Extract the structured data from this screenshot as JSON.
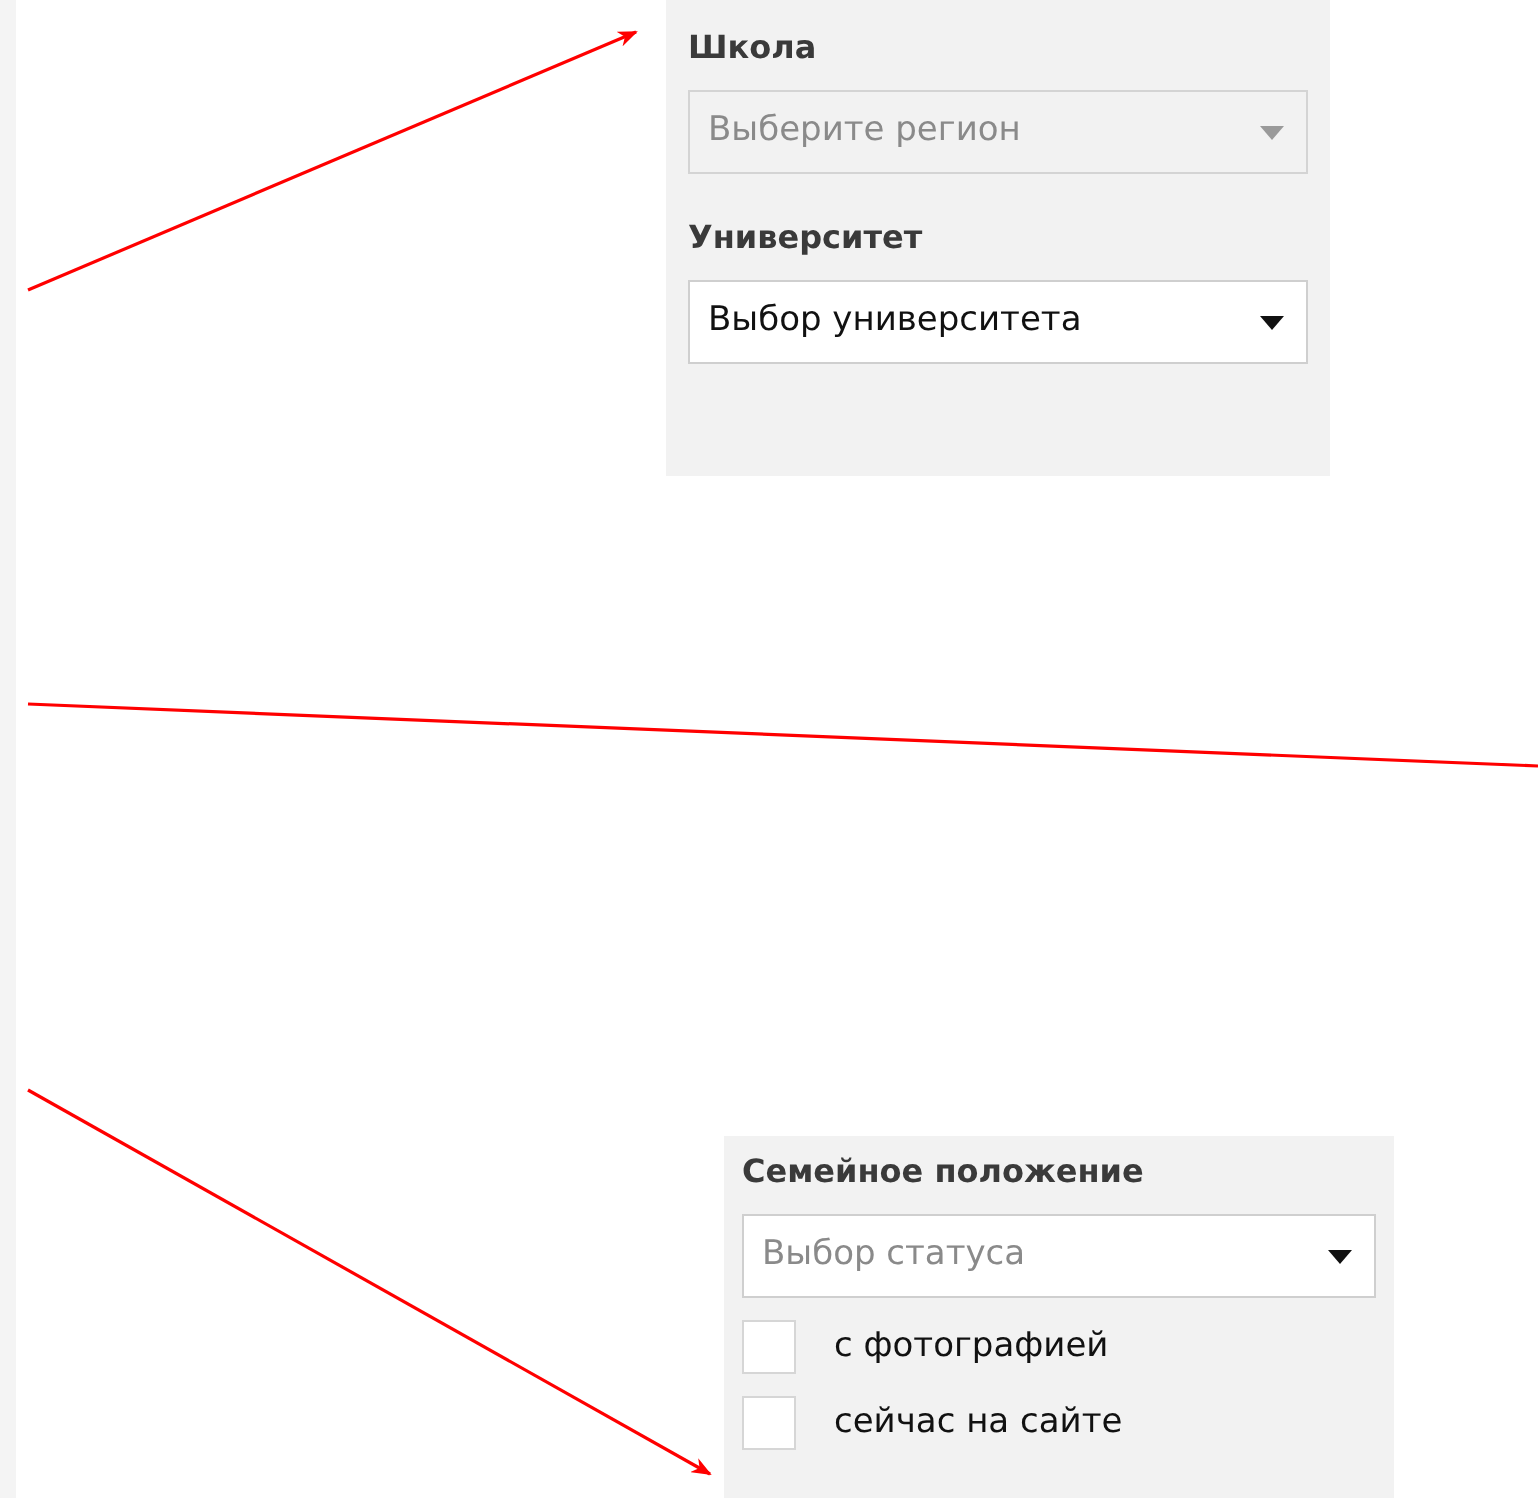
{
  "panels": [
    {
      "fields": [
        {
          "kind": "select",
          "label": "Школа",
          "placeholder": "Выберите регион",
          "disabled": true
        },
        {
          "kind": "select",
          "label": "Университет",
          "value": "Выбор университета",
          "disabled": false
        }
      ]
    },
    {
      "fields": [
        {
          "kind": "select",
          "label": "Семейное положение",
          "placeholder": "Выбор статуса",
          "disabled": false
        },
        {
          "kind": "checkbox",
          "label": "с фотографией",
          "checked": false
        },
        {
          "kind": "checkbox",
          "label": "сейчас на сайте",
          "checked": false
        }
      ]
    }
  ]
}
